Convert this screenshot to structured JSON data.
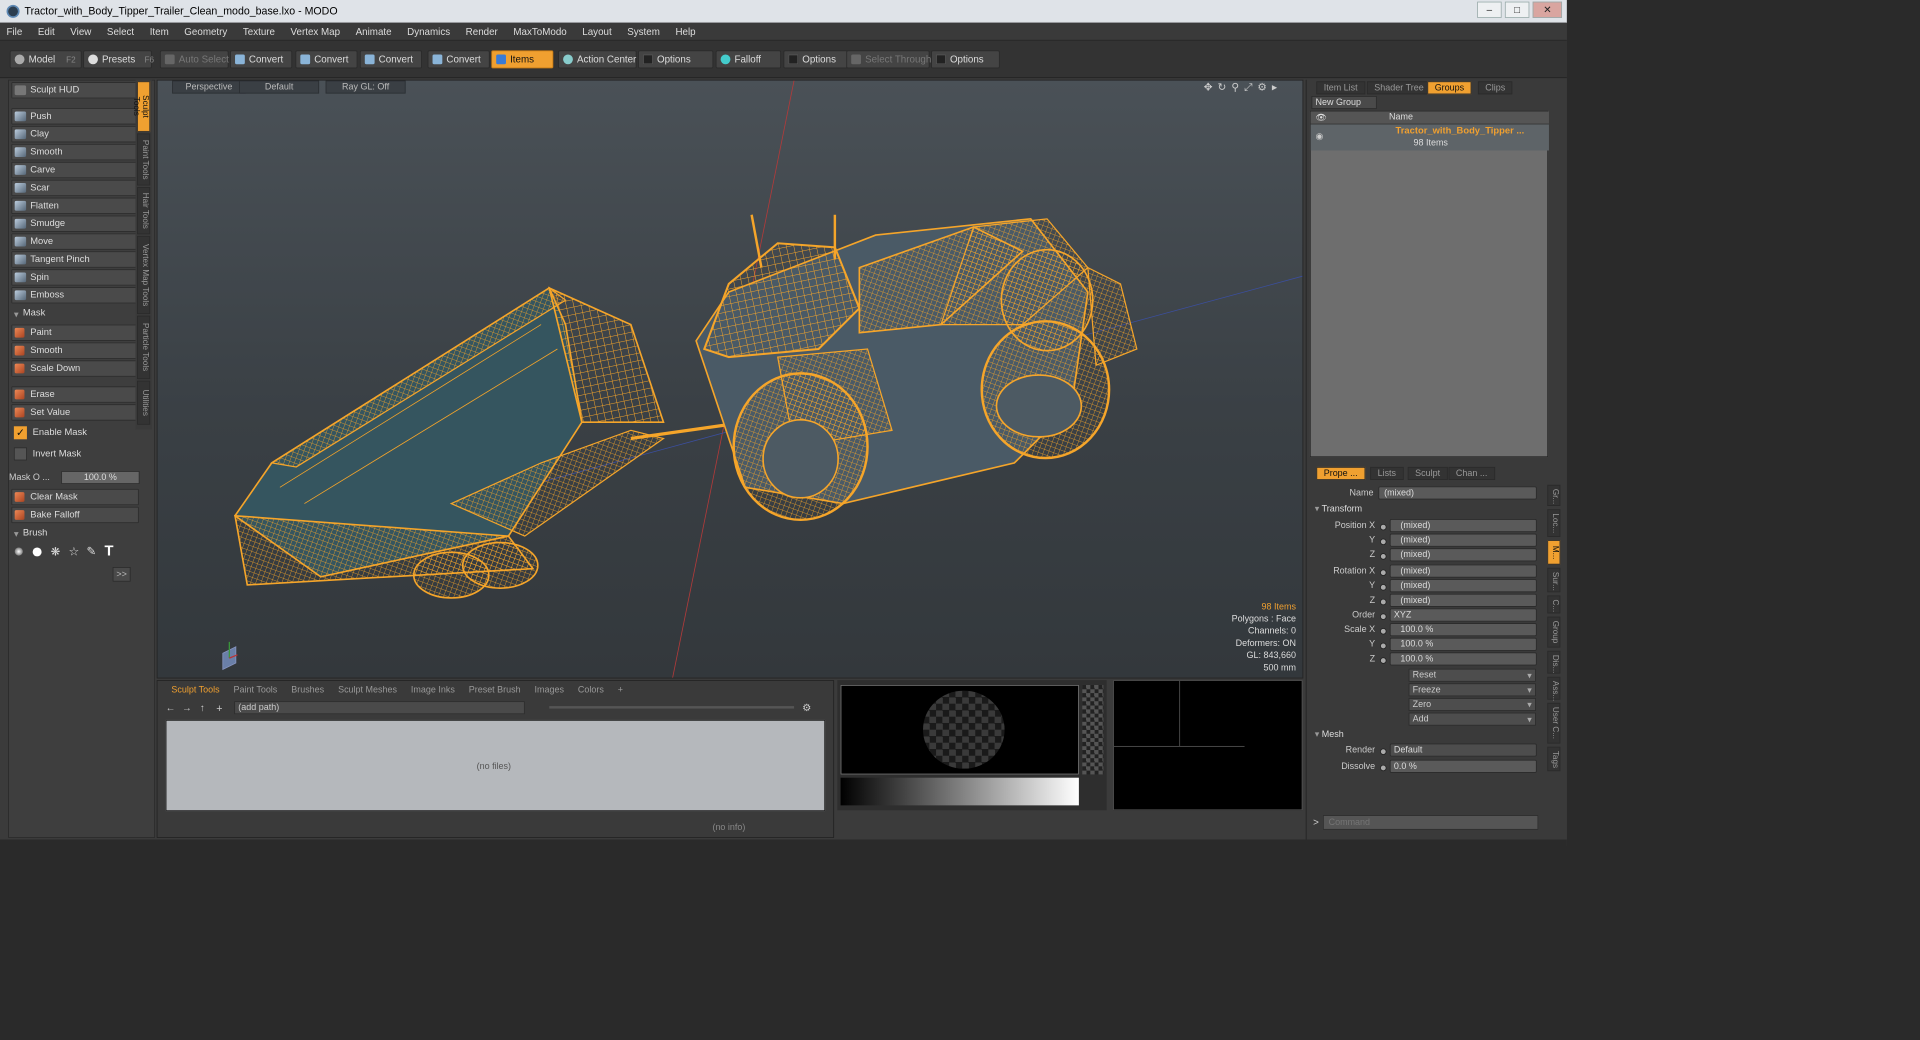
{
  "window": {
    "title": "Tractor_with_Body_Tipper_Trailer_Clean_modo_base.lxo - MODO"
  },
  "menu": [
    "File",
    "Edit",
    "View",
    "Select",
    "Item",
    "Geometry",
    "Texture",
    "Vertex Map",
    "Animate",
    "Dynamics",
    "Render",
    "MaxToModo",
    "Layout",
    "System",
    "Help"
  ],
  "toolbar": {
    "model": "Model",
    "model_key": "F2",
    "presets": "Presets",
    "presets_key": "F6",
    "auto_select": "Auto Select",
    "convert1": "Convert",
    "convert2": "Convert",
    "convert3": "Convert",
    "convert4": "Convert",
    "items": "Items",
    "action_center": "Action Center",
    "options1": "Options",
    "falloff": "Falloff",
    "options2": "Options",
    "select_through": "Select Through",
    "options3": "Options"
  },
  "sculpt": {
    "hud": "Sculpt HUD",
    "tools": [
      "Push",
      "Clay",
      "Smooth",
      "Carve",
      "Scar",
      "Flatten",
      "Smudge",
      "Move",
      "Tangent Pinch",
      "Spin",
      "Emboss"
    ],
    "mask_section": "Mask",
    "mask_tools": [
      "Paint",
      "Smooth",
      "Scale Down"
    ],
    "erase": "Erase",
    "set_value": "Set Value",
    "enable_mask": "Enable Mask",
    "invert_mask": "Invert Mask",
    "mask_opacity_label": "Mask O ...",
    "mask_opacity_value": "100.0 %",
    "clear_mask": "Clear Mask",
    "bake_falloff": "Bake Falloff",
    "brush_section": "Brush",
    "more": ">>"
  },
  "vtabs": [
    "Sculpt Tools",
    "Paint Tools",
    "Hair Tools",
    "Vertex Map Tools",
    "Particle Tools",
    "Utilities"
  ],
  "viewport": {
    "view": "Perspective",
    "shading": "Default",
    "raygl": "Ray GL: Off",
    "stats": {
      "items": "98 Items",
      "polygons": "Polygons : Face",
      "channels": "Channels: 0",
      "deformers": "Deformers: ON",
      "gl": "GL: 843,660",
      "scale": "500 mm"
    }
  },
  "bottom": {
    "tabs": [
      "Sculpt Tools",
      "Paint Tools",
      "Brushes",
      "Sculpt Meshes",
      "Image Inks",
      "Preset Brush",
      "Images",
      "Colors"
    ],
    "path": "(add path)",
    "nofiles": "(no files)",
    "noinfo": "(no info)"
  },
  "right": {
    "top_tabs": [
      "Item List",
      "Shader Tree",
      "Groups",
      "Clips"
    ],
    "new_group": "New Group",
    "name_col": "Name",
    "group_name": "Tractor_with_Body_Tipper ...",
    "group_count": "98 Items",
    "prop_tabs": [
      "Prope ...",
      "Lists",
      "Sculpt",
      "Chan ..."
    ],
    "side_tabs": [
      "Gr...",
      "Loc...",
      "M...",
      "Sur...",
      "C...",
      "Group",
      "Dis...",
      "Ass...",
      "User C...",
      "Tags"
    ],
    "props": {
      "name_label": "Name",
      "name_value": "(mixed)",
      "transform": "Transform",
      "position_x": "Position X",
      "rotation_x": "Rotation X",
      "scale_x": "Scale X",
      "y": "Y",
      "z": "Z",
      "mixed": "(mixed)",
      "order_label": "Order",
      "order_value": "XYZ",
      "scale_value": "100.0 %",
      "reset": "Reset",
      "freeze": "Freeze",
      "zero": "Zero",
      "add": "Add",
      "mesh": "Mesh",
      "render_label": "Render",
      "render_value": "Default",
      "dissolve_label": "Dissolve",
      "dissolve_value": "0.0 %"
    },
    "command_placeholder": "Command"
  },
  "colors": {
    "accent": "#f0a030",
    "wire": "#f5a52a"
  }
}
